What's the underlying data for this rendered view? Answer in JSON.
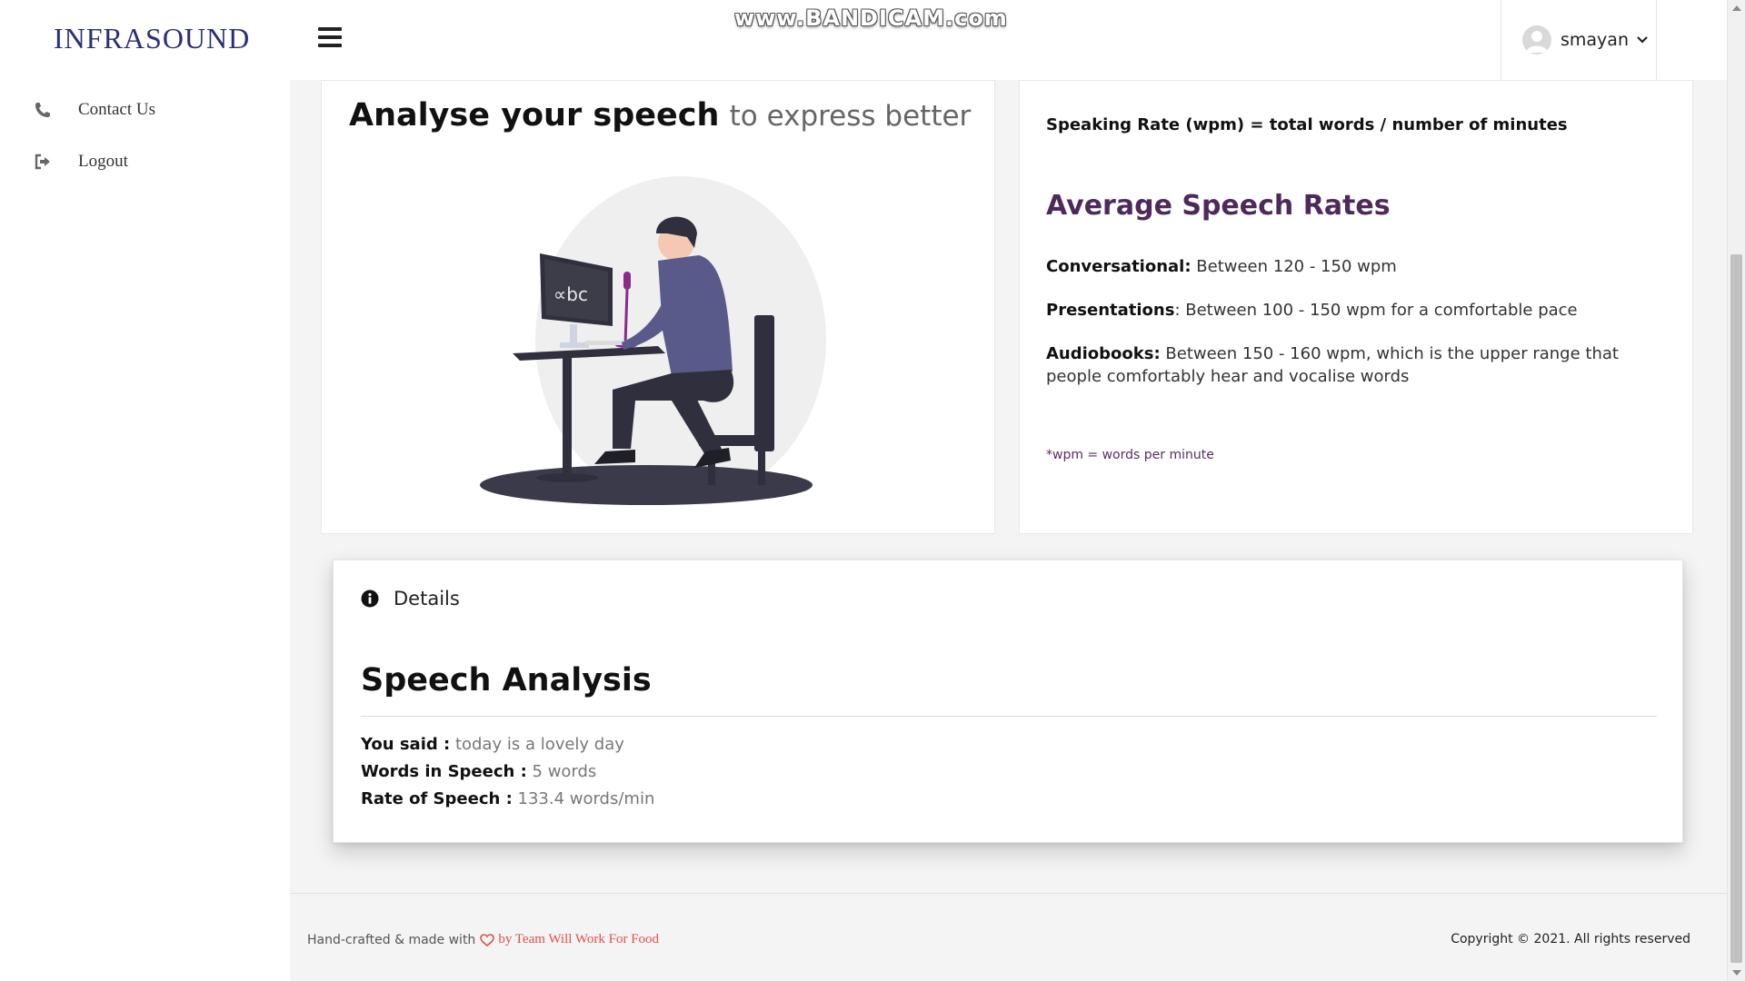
{
  "header": {
    "brand": "INFRASOUND",
    "watermark": "www.BANDICAM.com",
    "user": {
      "name": "smayan"
    }
  },
  "sidebar": {
    "items": [
      {
        "label": "Contact Us",
        "icon": "phone-icon"
      },
      {
        "label": "Logout",
        "icon": "sign-out-icon"
      }
    ]
  },
  "hero": {
    "title_bold": "Analyse your speech",
    "title_light": "to express better",
    "screen_text": "∝bc"
  },
  "rates": {
    "formula": "Speaking Rate (wpm) = total words / number of minutes",
    "title": "Average Speech Rates",
    "items": [
      {
        "key": "Conversational:",
        "value": " Between 120 - 150 wpm"
      },
      {
        "key": "Presentations",
        "value": ": Between 100 - 150 wpm for a comfortable pace"
      },
      {
        "key": "Audiobooks:",
        "value": " Between 150 - 160 wpm, which is the upper range that people comfortably hear and vocalise words"
      }
    ],
    "note": "*wpm = words per minute"
  },
  "details": {
    "label": "Details",
    "title": "Speech Analysis",
    "results": [
      {
        "key": "You said :",
        "value": " today is a lovely day"
      },
      {
        "key": "Words in Speech :",
        "value": " 5 words"
      },
      {
        "key": "Rate of Speech :",
        "value": " 133.4 words/min"
      }
    ]
  },
  "footer": {
    "left_text": "Hand-crafted & made with",
    "team": "by Team Will Work For Food",
    "copyright": "Copyright © 2021. All rights reserved"
  },
  "colors": {
    "brand": "#2b2f7a",
    "accent_purple": "#4e2a5c",
    "heart": "#e05050"
  }
}
